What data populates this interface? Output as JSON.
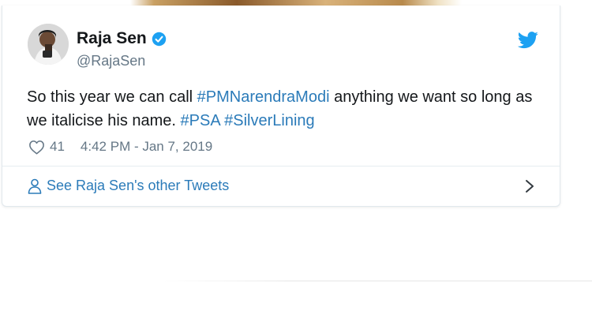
{
  "tweet": {
    "author": {
      "name": "Raja Sen",
      "handle": "@RajaSen",
      "verified": true
    },
    "text_segments": [
      {
        "text": "So this year we can call ",
        "type": "text"
      },
      {
        "text": "#PMNarendraModi",
        "type": "hashtag"
      },
      {
        "text": " anything we want so long as we italicise his name. ",
        "type": "text"
      },
      {
        "text": "#PSA",
        "type": "hashtag"
      },
      {
        "text": " ",
        "type": "text"
      },
      {
        "text": "#SilverLining",
        "type": "hashtag"
      }
    ],
    "like_count": "41",
    "timestamp": "4:42 PM - Jan 7, 2019"
  },
  "footer": {
    "see_more_label": "See Raja Sen's other Tweets"
  },
  "icons": {
    "brand": "twitter-icon",
    "verified": "verified-badge-icon",
    "like": "heart-icon",
    "profile": "person-icon",
    "more": "chevron-right-icon"
  },
  "colors": {
    "link": "#2b7bb9",
    "twitter_blue": "#1da1f2",
    "secondary_text": "#657786",
    "primary_text": "#14171a"
  }
}
